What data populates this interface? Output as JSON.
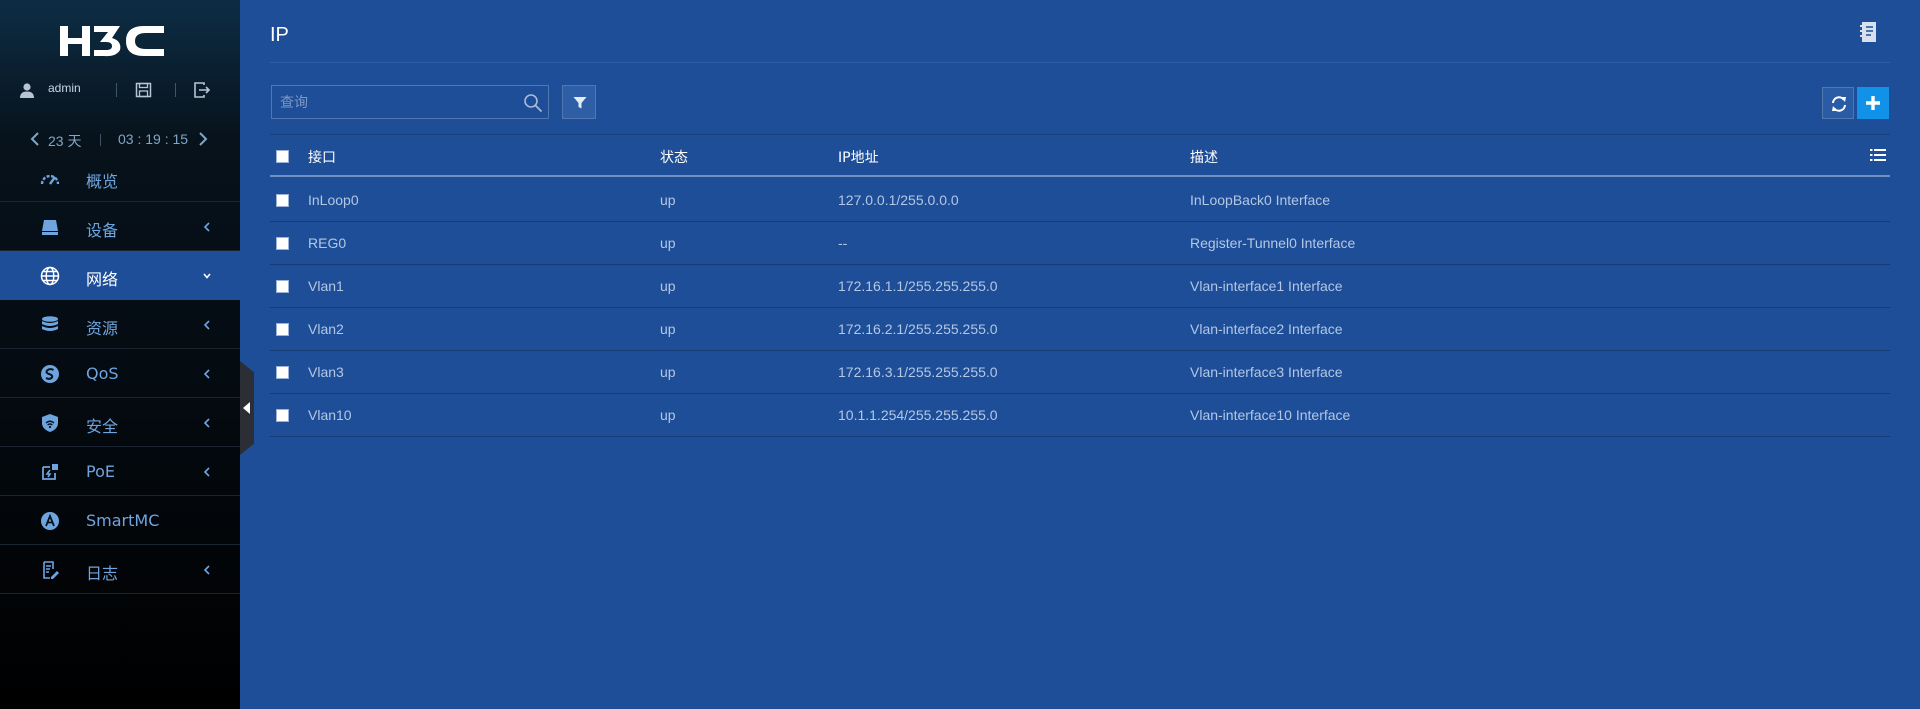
{
  "brand": {
    "logo_text": "H3C"
  },
  "user": {
    "name": "admin"
  },
  "uptime": {
    "days": "23 天",
    "clock": "03 : 19 : 15"
  },
  "sidebar": {
    "items": [
      {
        "label": "概览",
        "icon": "dashboard-gauge-icon",
        "has_submenu": false,
        "active": false
      },
      {
        "label": "设备",
        "icon": "device-icon",
        "has_submenu": true,
        "active": false
      },
      {
        "label": "网络",
        "icon": "globe-icon",
        "has_submenu": true,
        "active": true
      },
      {
        "label": "资源",
        "icon": "database-icon",
        "has_submenu": true,
        "active": false
      },
      {
        "label": "QoS",
        "icon": "qos-icon",
        "has_submenu": true,
        "active": false
      },
      {
        "label": "安全",
        "icon": "shield-icon",
        "has_submenu": true,
        "active": false
      },
      {
        "label": "PoE",
        "icon": "poe-plug-icon",
        "has_submenu": true,
        "active": false
      },
      {
        "label": "SmartMC",
        "icon": "smartmc-icon",
        "has_submenu": false,
        "active": false
      },
      {
        "label": "日志",
        "icon": "log-document-icon",
        "has_submenu": true,
        "active": false
      }
    ]
  },
  "page": {
    "title": "IP"
  },
  "search": {
    "placeholder": "查询",
    "value": ""
  },
  "table": {
    "headers": {
      "interface": "接口",
      "status": "状态",
      "ip": "IP地址",
      "description": "描述"
    },
    "rows": [
      {
        "interface": "InLoop0",
        "status": "up",
        "ip": "127.0.0.1/255.0.0.0",
        "description": "InLoopBack0 Interface"
      },
      {
        "interface": "REG0",
        "status": "up",
        "ip": "--",
        "description": "Register-Tunnel0 Interface"
      },
      {
        "interface": "Vlan1",
        "status": "up",
        "ip": "172.16.1.1/255.255.255.0",
        "description": "Vlan-interface1 Interface"
      },
      {
        "interface": "Vlan2",
        "status": "up",
        "ip": "172.16.2.1/255.255.255.0",
        "description": "Vlan-interface2 Interface"
      },
      {
        "interface": "Vlan3",
        "status": "up",
        "ip": "172.16.3.1/255.255.255.0",
        "description": "Vlan-interface3 Interface"
      },
      {
        "interface": "Vlan10",
        "status": "up",
        "ip": "10.1.1.254/255.255.255.0",
        "description": "Vlan-interface10 Interface"
      }
    ]
  },
  "colors": {
    "main_bg": "#1e4e97",
    "sidebar_bg": "#000000",
    "nav_text": "#6fa5df",
    "add_button": "#1291e8"
  }
}
